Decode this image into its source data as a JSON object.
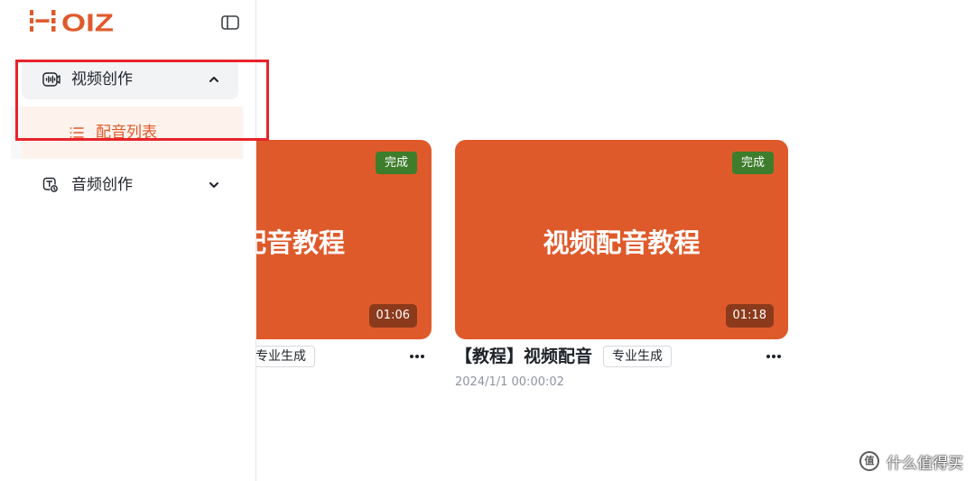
{
  "brand": {
    "logo_text": "NOIZ"
  },
  "sidebar": {
    "toggle_icon": "sidebar-toggle-icon",
    "menus": [
      {
        "label": "视频创作",
        "icon": "video-waveform-icon",
        "chevron_icon": "chevron-up-icon",
        "expanded": true,
        "children": [
          {
            "label": "配音列表",
            "icon": "list-icon",
            "active": true
          }
        ]
      },
      {
        "label": "音频创作",
        "icon": "audio-text-icon",
        "chevron_icon": "chevron-down-icon",
        "expanded": false
      }
    ]
  },
  "cards": [
    {
      "cover_title": "配音教程",
      "status": "完成",
      "duration": "01:06",
      "tag": "专业生成",
      "more_icon": "more-ellipsis-icon"
    },
    {
      "cover_title": "视频配音教程",
      "status": "完成",
      "duration": "01:18",
      "title": "【教程】视频配音",
      "tag": "专业生成",
      "date": "2024/1/1 00:00:02",
      "more_icon": "more-ellipsis-icon"
    }
  ],
  "colors": {
    "brand": "#e05a2b",
    "card_cover": "#df5a2b",
    "status_badge": "#3e7d2c",
    "duration_badge": "#8c3a1c",
    "text_primary": "#1f2329",
    "text_secondary": "#8f959e",
    "menu_open_bg": "#f2f3f5",
    "submenu_active_bg": "#fdf3ec",
    "annotation": "#e8232b"
  },
  "watermark": {
    "icon_char": "值",
    "text": "什么值得买"
  }
}
